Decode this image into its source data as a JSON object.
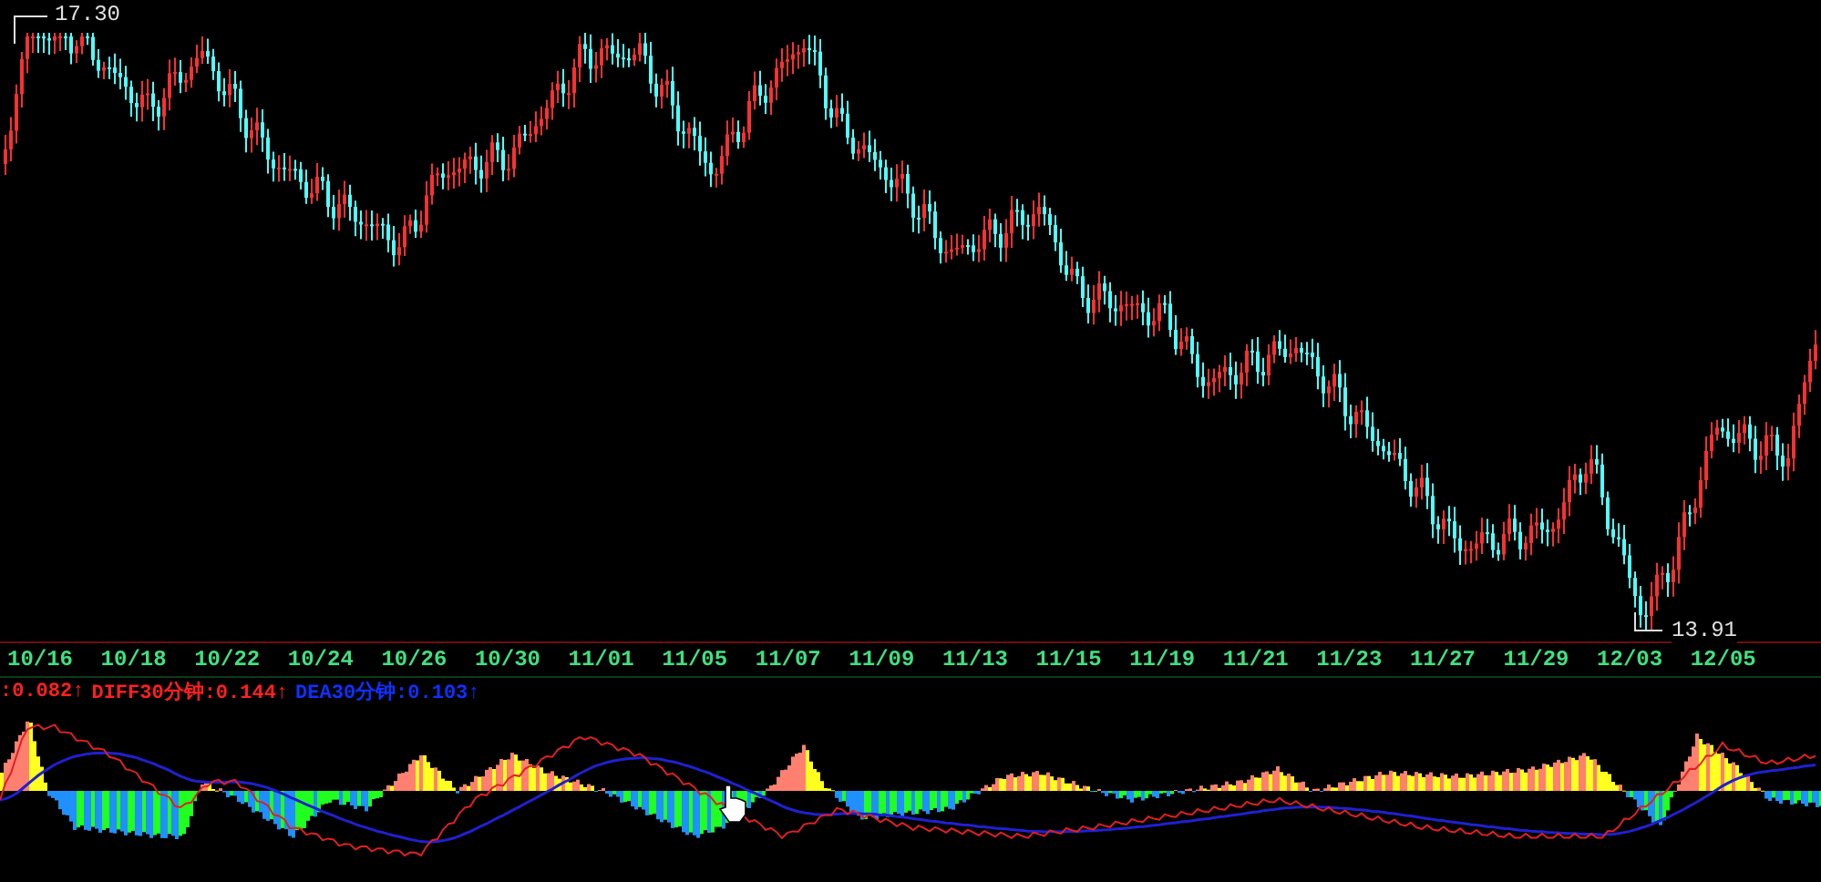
{
  "price_chart": {
    "high_label": "17.30",
    "low_label": "13.91"
  },
  "x_axis": {
    "labels": [
      "10/16",
      "10/18",
      "10/22",
      "10/24",
      "10/26",
      "10/30",
      "11/01",
      "11/05",
      "11/07",
      "11/09",
      "11/13",
      "11/15",
      "11/19",
      "11/21",
      "11/23",
      "11/27",
      "11/29",
      "12/03",
      "12/05"
    ]
  },
  "indicator": {
    "readings": [
      {
        "text": ":0.082↑",
        "color": "#ff2020"
      },
      {
        "text": "DIFF30分钟:0.144↑",
        "color": "#ff2020"
      },
      {
        "text": "DEA30分钟:0.103↑",
        "color": "#1030ff"
      }
    ]
  }
}
